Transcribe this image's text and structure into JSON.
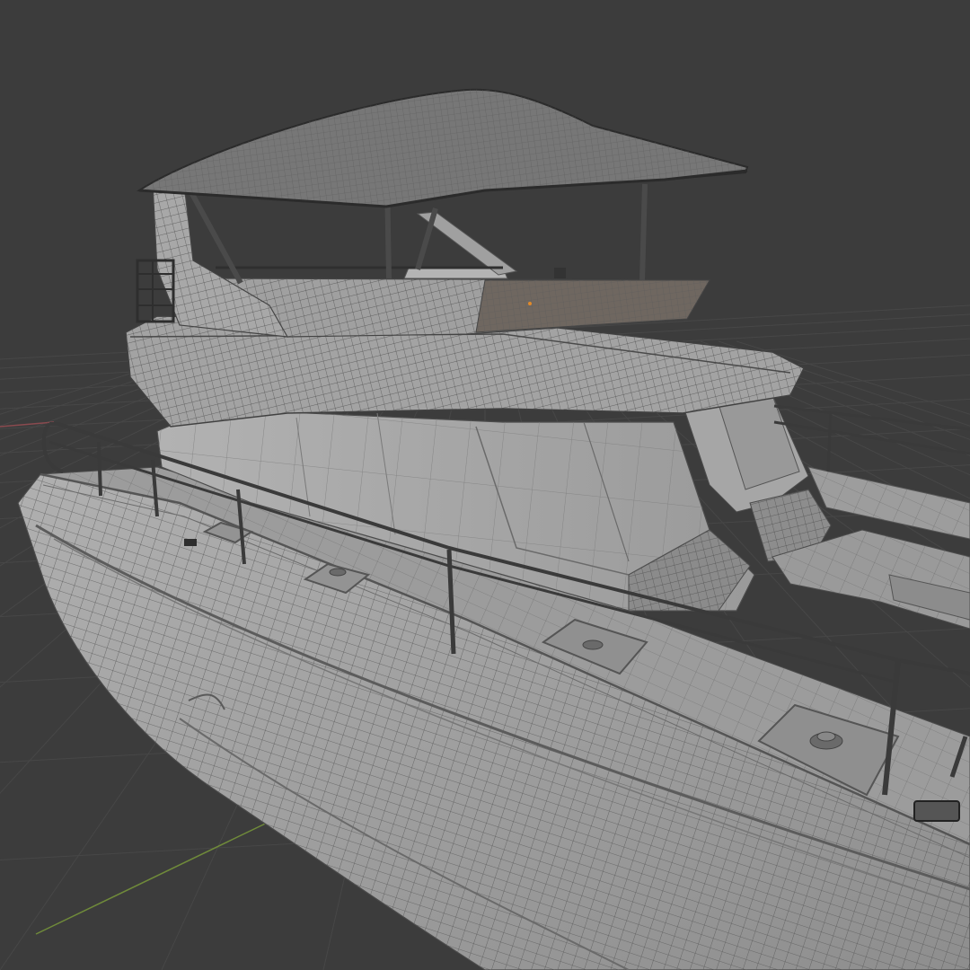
{
  "scene": {
    "subject": "motor yacht",
    "view_mode": "wireframe",
    "colors": {
      "background": "#3c3c3c",
      "grid_line": "#474747",
      "x_axis": "#8a4a4f",
      "y_axis": "#6f8a3a",
      "hull": "#a7a7a7",
      "hull_shadow": "#8c8c8c",
      "deck": "#9b9b9b",
      "cabin": "#aaaaaa",
      "roof_canopy": "#767676",
      "tinted_panel": "#6f6760",
      "railing": "#5a5a5a",
      "mesh_line": "#4a4a4a"
    }
  }
}
